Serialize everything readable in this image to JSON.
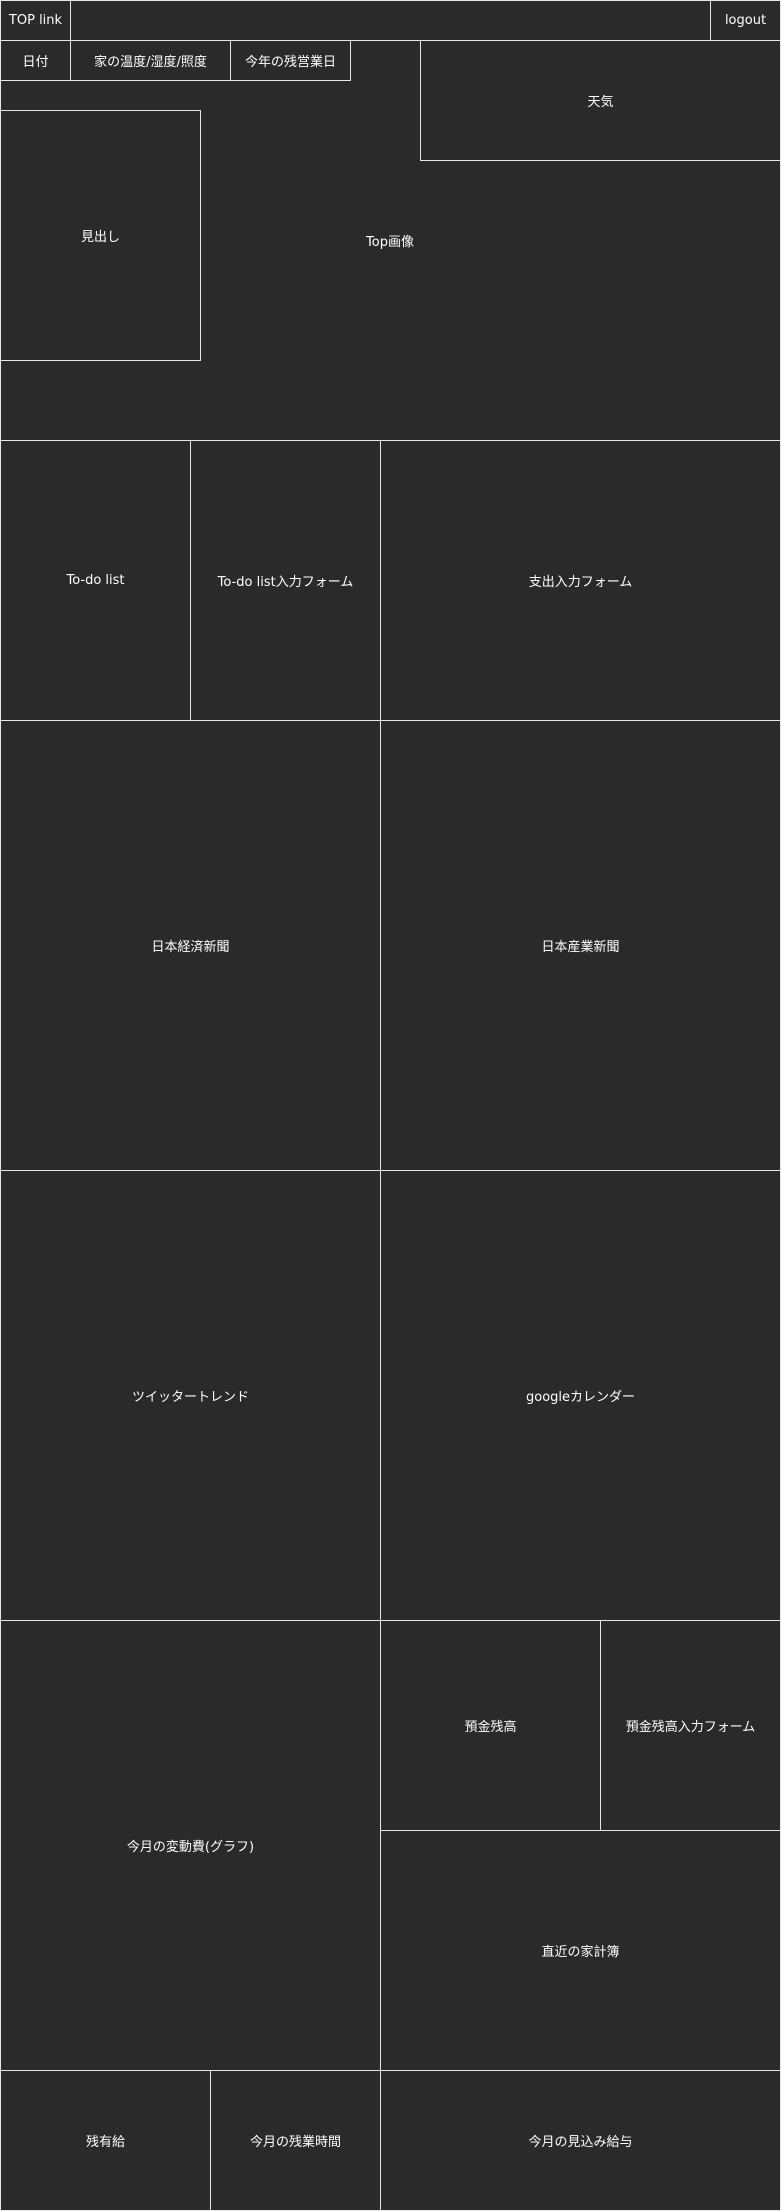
{
  "header": {
    "top_link": "TOP link",
    "logout": "logout"
  },
  "info_bar": {
    "date": "日付",
    "home_temp": "家の温度/湿度/照度",
    "holidays": "今年の残営業日"
  },
  "weather": "天気",
  "headline": "見出し",
  "top_image": "Top画像",
  "row2": {
    "todo_list": "To-do list",
    "todo_form": "To-do list入力フォーム",
    "expense_form": "支出入力フォーム"
  },
  "news": {
    "nikkei": "日本経済新聞",
    "sankei": "日本産業新聞"
  },
  "social": {
    "twitter": "ツイッタートレンド",
    "calendar": "googleカレンダー"
  },
  "finance": {
    "graph": "今月の変動費(グラフ)",
    "deposit": "預金残高",
    "deposit_form": "預金残高入力フォーム",
    "ledger": "直近の家計簿"
  },
  "footer": {
    "paid_leave": "残有給",
    "overtime": "今月の残業時間",
    "salary": "今月の見込み給与"
  }
}
